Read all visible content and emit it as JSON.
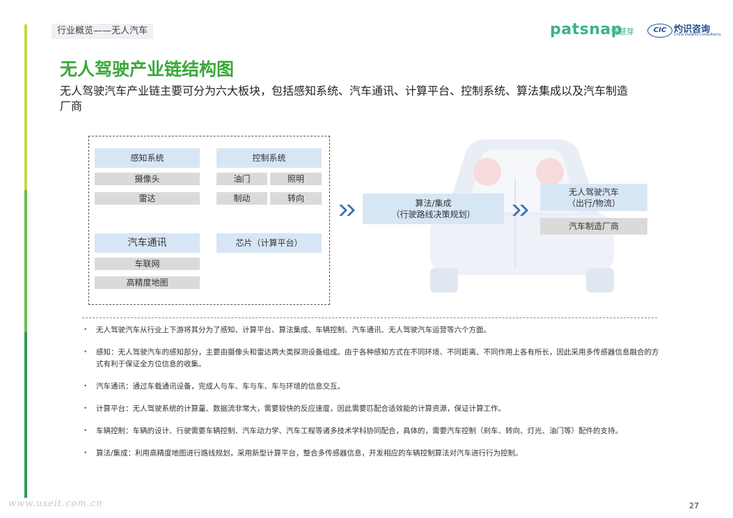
{
  "header": {
    "section_tag": "行业概览——无人汽车",
    "logo_patsnap": "patsnap",
    "logo_patsnap_cn": "智慧芽",
    "logo_cic": "CIC",
    "logo_cic_name": "灼识咨询",
    "logo_cic_sub": "China Insights Consultancy"
  },
  "title": "无人驾驶产业链结构图",
  "subtitle": "无人驾驶汽车产业链主要可分为六大板块，包括感知系统、汽车通讯、计算平台、控制系统、算法集成以及汽车制造厂商",
  "diagram": {
    "perception": {
      "header": "感知系统",
      "items": [
        "摄像头",
        "雷达"
      ]
    },
    "control": {
      "header": "控制系统",
      "items": [
        "油门",
        "照明",
        "制动",
        "转向"
      ]
    },
    "comm": {
      "header": "汽车通讯",
      "items": [
        "车联网",
        "高精度地图"
      ]
    },
    "chip": "芯片（计算平台）",
    "algo_line1": "算法/集成",
    "algo_line2": "（行驶路线决策规划）",
    "auto_line1": "无人驾驶汽车",
    "auto_line2": "（出行/物流）",
    "maker": "汽车制造厂商"
  },
  "notes": [
    "无人驾驶汽车从行业上下游将其分为了感知、计算平台、算法集成、车辆控制、汽车通讯、无人驾驶汽车运营等六个方面。",
    "感知：无人驾驶汽车的感知部分，主要由摄像头和雷达两大类探测设备组成。由于各种感知方式在不同环境、不同距离、不同作用上各有所长，因此采用多传感器信息融合的方式有利于保证全方位信息的收集。",
    "汽车通讯：通过车载通讯设备，完成人与车、车与车、车与环境的信息交互。",
    "计算平台：无人驾驶系统的计算量、数据流非常大，需要较快的反应速度，因此需要匹配合适效能的计算资源，保证计算工作。",
    "车辆控制：车辆的设计、行驶需要车辆控制、汽车动力学、汽车工程等诸多技术学科协同配合，具体的，需要汽车控制（刹车、转向、灯光、油门等）配件的支持。",
    "算法/集成：利用高精度地图进行路线规划，采用新型计算平台，整合多传感器信息，开发相应的车辆控制算法对汽车进行行为控制。"
  ],
  "footer": {
    "watermark": "www.useit.com.cn",
    "page_number": "27"
  }
}
